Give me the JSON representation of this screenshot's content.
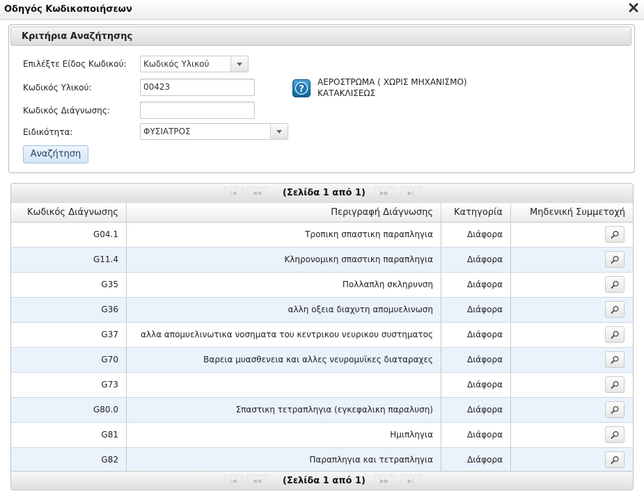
{
  "window": {
    "title": "Οδηγός Κωδικοποιήσεων"
  },
  "criteria": {
    "legend": "Κριτήρια Αναζήτησης",
    "code_type_label": "Επιλέξτε Είδος Κωδικού:",
    "code_type_value": "Κωδικός Υλικού",
    "material_code_label": "Κωδικός Υλικού:",
    "material_code_value": "00423",
    "diagnosis_code_label": "Κωδικός Διάγνωσης:",
    "diagnosis_code_value": "",
    "specialty_label": "Ειδικότητα:",
    "specialty_value": "ΦΥΣΙΑΤΡΟΣ",
    "material_desc_line1": "ΑΕΡΟΣΤΡΩΜΑ ( ΧΩΡΙΣ ΜΗΧΑΝΙΣΜΟ)",
    "material_desc_line2": "ΚΑΤΑΚΛΙΣΕΩΣ",
    "search_button": "Αναζήτηση"
  },
  "pager": {
    "text": "(Σελίδα 1 από 1)"
  },
  "table": {
    "headers": [
      "Κωδικός Διάγνωσης",
      "Περιγραφή Διάγνωσης",
      "Κατηγορία",
      "Μηδενική Συμμετοχή"
    ],
    "rows": [
      {
        "code": "G04.1",
        "description": "Τροπικη σπαστικη παραπληγια",
        "category": "Διάφορα"
      },
      {
        "code": "G11.4",
        "description": "Κληρονομικη σπαστικη παραπληγια",
        "category": "Διάφορα"
      },
      {
        "code": "G35",
        "description": "Πολλαπλη σκληρυνση",
        "category": "Διάφορα"
      },
      {
        "code": "G36",
        "description": "αλλη οξεια διαχυτη απομυελινωση",
        "category": "Διάφορα"
      },
      {
        "code": "G37",
        "description": "αλλα απομυελινωτικα νοσηματα του κεντρικου νευρικου συστηματος",
        "category": "Διάφορα"
      },
      {
        "code": "G70",
        "description": "Βαρεια μυασθενεια και αλλες νευρομυϊκες διαταραχες",
        "category": "Διάφορα"
      },
      {
        "code": "G73",
        "description": "",
        "category": "Διάφορα"
      },
      {
        "code": "G80.0",
        "description": "Σπαστικη τετραπληγια (εγκεφαλικη παραλυση)",
        "category": "Διάφορα"
      },
      {
        "code": "G81",
        "description": "Ημιπληγια",
        "category": "Διάφορα"
      },
      {
        "code": "G82",
        "description": "Παραπληγια και τετραπληγια",
        "category": "Διάφορα"
      }
    ]
  },
  "icons": {
    "close": "close-icon",
    "help": "help-icon",
    "magnifier": "magnifier-icon",
    "pager_first": "first-page-icon",
    "pager_prev": "prev-page-icon",
    "pager_next": "next-page-icon",
    "pager_last": "last-page-icon"
  }
}
